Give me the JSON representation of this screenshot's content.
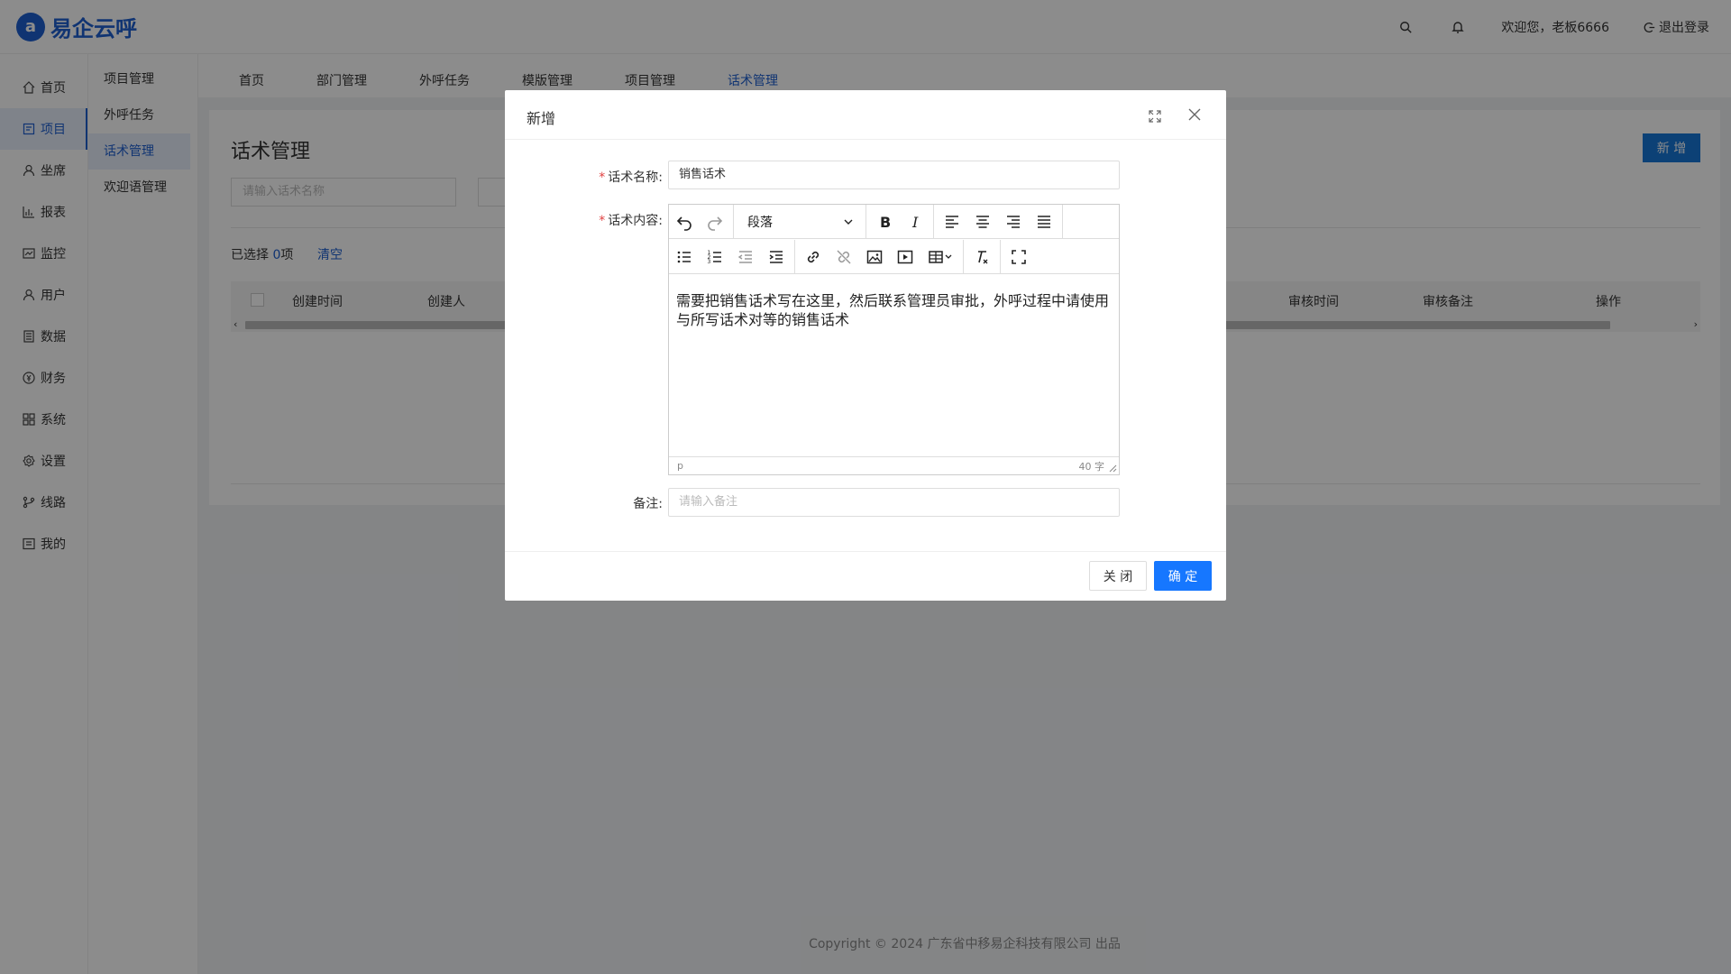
{
  "app": {
    "logo_mark": "a",
    "name": "易企云呼"
  },
  "topbar": {
    "welcome": "欢迎您，老板6666",
    "logout": "退出登录"
  },
  "sidebar": {
    "items": [
      {
        "label": "首页",
        "icon": "home-icon"
      },
      {
        "label": "项目",
        "icon": "project-icon"
      },
      {
        "label": "坐席",
        "icon": "agent-icon"
      },
      {
        "label": "报表",
        "icon": "report-icon"
      },
      {
        "label": "监控",
        "icon": "monitor-icon"
      },
      {
        "label": "用户",
        "icon": "user-icon"
      },
      {
        "label": "数据",
        "icon": "data-icon"
      },
      {
        "label": "财务",
        "icon": "finance-icon"
      },
      {
        "label": "系统",
        "icon": "system-icon"
      },
      {
        "label": "设置",
        "icon": "settings-icon"
      },
      {
        "label": "线路",
        "icon": "route-icon"
      },
      {
        "label": "我的",
        "icon": "mine-icon"
      }
    ]
  },
  "subnav": {
    "items": [
      "项目管理",
      "外呼任务",
      "话术管理",
      "欢迎语管理"
    ]
  },
  "tabs": [
    "首页",
    "部门管理",
    "外呼任务",
    "模版管理",
    "项目管理",
    "话术管理"
  ],
  "page": {
    "title": "话术管理",
    "search_placeholder": "请输入话术名称",
    "add_button": "新 增",
    "selected_prefix": "已选择",
    "selected_count": "0",
    "selected_suffix": "项",
    "clear": "清空",
    "columns": [
      "创建时间",
      "创建人",
      "审核时间",
      "审核备注",
      "操作"
    ]
  },
  "modal": {
    "title": "新增",
    "name_label": "话术名称:",
    "name_value": "销售话术",
    "content_label": "话术内容:",
    "format_select": "段落",
    "content_text": "需要把销售话术写在这里，然后联系管理员审批，外呼过程中请使用与所写话术对等的销售话术",
    "status_tag": "p",
    "word_count": "40 字",
    "remark_label": "备注:",
    "remark_placeholder": "请输入备注",
    "close_button": "关 闭",
    "ok_button": "确 定"
  },
  "footer": "Copyright © 2024 广东省中移易企科技有限公司 出品",
  "colors": {
    "primary": "#1e5fd0",
    "button": "#1677ff",
    "required": "#e04040"
  }
}
